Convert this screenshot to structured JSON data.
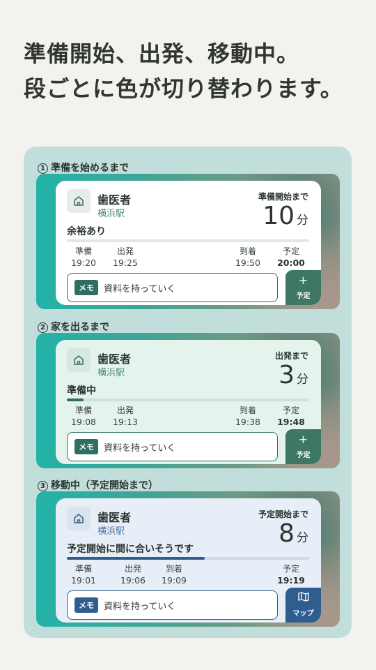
{
  "headline": {
    "line1": "準備開始、出発、移動中。",
    "line2": "段ごとに色が切り替わります。"
  },
  "sections": [
    {
      "number": "1",
      "label": "準備を始めるまで",
      "place": "歯医者",
      "station": "横浜駅",
      "until_label": "準備開始まで",
      "count": "10",
      "unit": "分",
      "status": "余裕あり",
      "progress": 0,
      "times": [
        {
          "label": "準備",
          "value": "19:20"
        },
        {
          "label": "出発",
          "value": "19:25"
        },
        {
          "label": "到着",
          "value": "19:50"
        },
        {
          "label": "予定",
          "value": "20:00"
        }
      ],
      "memo_tag": "メモ",
      "memo_text": "資料を持っていく",
      "action_icon": "plus-icon",
      "action_symbol": "+",
      "action_label": "予定"
    },
    {
      "number": "2",
      "label": "家を出るまで",
      "place": "歯医者",
      "station": "横浜駅",
      "until_label": "出発まで",
      "count": "3",
      "unit": "分",
      "status": "準備中",
      "progress": 0.07,
      "times": [
        {
          "label": "準備",
          "value": "19:08"
        },
        {
          "label": "出発",
          "value": "19:13"
        },
        {
          "label": "到着",
          "value": "19:38"
        },
        {
          "label": "予定",
          "value": "19:48"
        }
      ],
      "memo_tag": "メモ",
      "memo_text": "資料を持っていく",
      "action_icon": "plus-icon",
      "action_symbol": "+",
      "action_label": "予定"
    },
    {
      "number": "3",
      "label": "移動中（予定開始まで）",
      "place": "歯医者",
      "station": "横浜駅",
      "until_label": "予定開始まで",
      "count": "8",
      "unit": "分",
      "status": "予定開始に間に合いそうです",
      "progress": 0.57,
      "times": [
        {
          "label": "準備",
          "value": "19:01"
        },
        {
          "label": "出発",
          "value": "19:06"
        },
        {
          "label": "到着",
          "value": "19:09"
        },
        {
          "label": "予定",
          "value": "19:19"
        }
      ],
      "memo_tag": "メモ",
      "memo_text": "資料を持っていく",
      "action_icon": "map-icon",
      "action_symbol": "🕮",
      "action_label": "マップ"
    }
  ],
  "colors": {
    "green_accent": "#2f6f61",
    "blue_accent": "#2f5d8e",
    "panel_bg": "#c2dedb"
  }
}
